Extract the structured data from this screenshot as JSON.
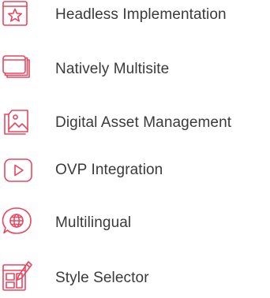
{
  "accent_color": "#e8475f",
  "features": [
    {
      "label": "Headless Implementation",
      "icon": "star-window-icon"
    },
    {
      "label": "Natively Multisite",
      "icon": "stacked-windows-icon"
    },
    {
      "label": "Digital Asset Management",
      "icon": "image-folder-icon"
    },
    {
      "label": "OVP Integration",
      "icon": "play-button-icon"
    },
    {
      "label": "Multilingual",
      "icon": "globe-chat-icon"
    },
    {
      "label": "Style Selector",
      "icon": "layout-pencil-icon"
    }
  ]
}
